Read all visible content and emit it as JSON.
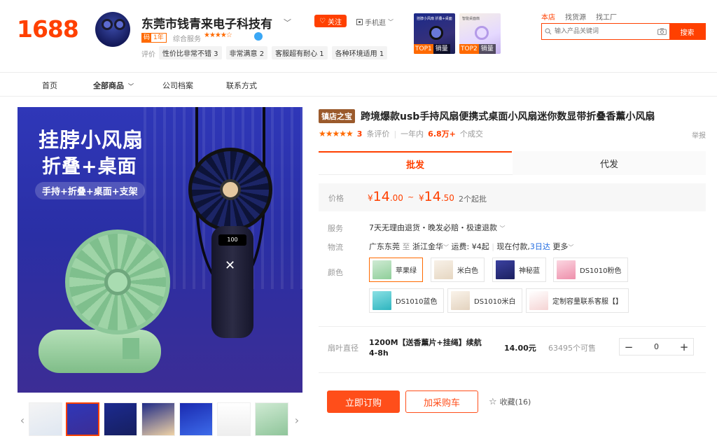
{
  "header": {
    "logo": "1688",
    "shop_name": "东莞市钱青来电子科技有",
    "year_badge_k": "码",
    "year_badge_y": "1年",
    "rating_label": "综合服务",
    "rating_stars": "★★★★☆",
    "follow_label": "关注",
    "mobile_shop_label": "手机逛",
    "eval_label": "评价",
    "eval_tags": [
      "性价比非常不错 3",
      "非常满意 2",
      "客服超有耐心 1",
      "各种环境适用 1"
    ],
    "top_items": [
      {
        "rank": "TOP1",
        "label": "销量",
        "mini": "挂脖小风扇 折叠+桌面"
      },
      {
        "rank": "TOP2",
        "label": "销量",
        "mini": "智能桌面扇"
      }
    ],
    "search_tabs": [
      "本店",
      "找货源",
      "找工厂"
    ],
    "search_placeholder": "输入产品关键词",
    "search_button": "搜索"
  },
  "nav": {
    "items": [
      "首页",
      "全部商品",
      "公司档案",
      "联系方式"
    ]
  },
  "gallery": {
    "hero_line1": "挂脖小风扇",
    "hero_line2": "折叠+桌面",
    "hero_tag": "手持+折叠+桌面+支架",
    "led_text": "100"
  },
  "product": {
    "badge": "镇店之宝",
    "title": "跨境爆款usb手持风扇便携式桌面小风扇迷你数显带折叠香薰小风扇",
    "review_stars": "★★★★★",
    "review_count": "3",
    "review_label": "条评价",
    "sales_prefix": "一年内",
    "sales_value": "6.8万+",
    "sales_suffix": "个成交",
    "report": "举报",
    "tabs": [
      "批发",
      "代发"
    ],
    "price_label": "价格",
    "price_low": {
      "cur": "¥",
      "int": "14",
      "dec": ".00"
    },
    "price_high": {
      "cur": "¥",
      "int": "14",
      "dec": ".50"
    },
    "price_sep": "~",
    "min_order": "2个起批",
    "service_label": "服务",
    "service_value": "7天无理由退货・晚发必赔・极速退款",
    "logistics_label": "物流",
    "logistics_from": "广东东莞",
    "logistics_to_word": "至",
    "logistics_to": "浙江金华",
    "logistics_fee": "运费: ¥4起",
    "logistics_pay": "现在付款,",
    "logistics_arrive": "3日达",
    "logistics_more": "更多",
    "color_label": "颜色",
    "colors": [
      {
        "name": "苹果绿",
        "swatch": "#8fcf9a"
      },
      {
        "name": "米白色",
        "swatch": "#f1e6d6"
      },
      {
        "name": "神秘蓝",
        "swatch": "#2b2f7a"
      },
      {
        "name": "DS1010粉色",
        "swatch": "#f2a9c0"
      },
      {
        "name": "DS1010蓝色",
        "swatch": "#42c0c8"
      },
      {
        "name": "DS1010米白",
        "swatch": "#efe5d8"
      },
      {
        "name": "定制容量联系客服【】",
        "swatch": "#f5d4d4"
      }
    ],
    "spec_label": "扇叶直径",
    "spec_name": "1200M【送香薰片+挂绳】续航4-8h",
    "spec_price": "14.00元",
    "spec_stock": "63495个可售",
    "qty": "0",
    "order_button": "立即订购",
    "cart_button": "加采购车",
    "favorite": "收藏(16)"
  }
}
